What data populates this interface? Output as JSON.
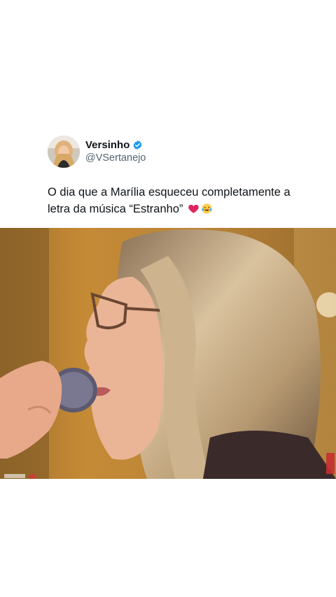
{
  "tweet": {
    "author": {
      "display_name": "Versinho",
      "handle": "@VSertanejo",
      "verified": true,
      "verified_icon": "verified-badge-icon",
      "verified_color": "#1d9bf0"
    },
    "text": "O dia que a Marília esqueceu completamente a letra da música “Estranho”",
    "emojis": [
      "red-heart-emoji",
      "tears-of-joy-emoji"
    ]
  },
  "media": {
    "type": "video-frame",
    "description_icon": "singer-with-microphone-image"
  }
}
